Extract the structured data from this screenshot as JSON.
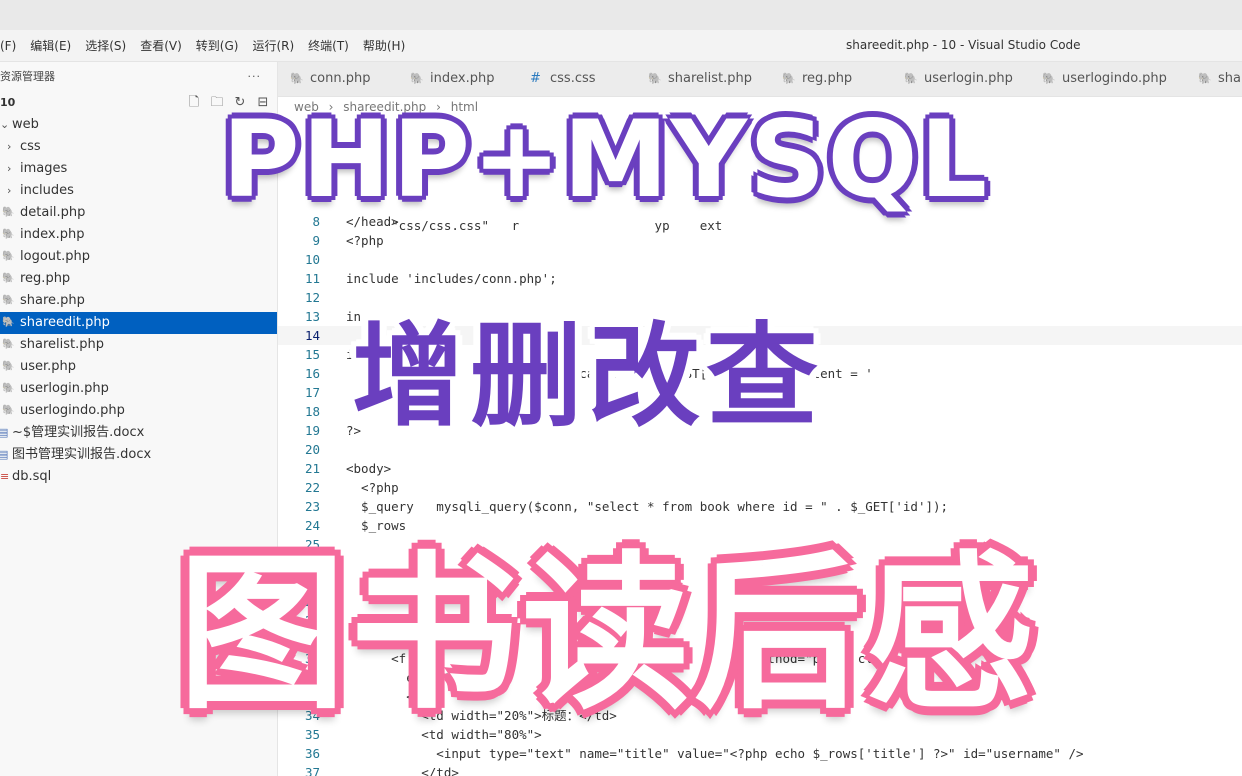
{
  "menubar": {
    "items": [
      "(F)",
      "编辑(E)",
      "选择(S)",
      "查看(V)",
      "转到(G)",
      "运行(R)",
      "终端(T)",
      "帮助(H)"
    ],
    "window_title": "shareedit.php - 10 - Visual Studio Code"
  },
  "explorer": {
    "header": "资源管理器",
    "more": "···",
    "folder": "10",
    "tree": [
      {
        "label": "web",
        "type": "folder-open"
      },
      {
        "label": "css",
        "type": "folder"
      },
      {
        "label": "images",
        "type": "folder"
      },
      {
        "label": "includes",
        "type": "folder"
      },
      {
        "label": "detail.php",
        "type": "php"
      },
      {
        "label": "index.php",
        "type": "php"
      },
      {
        "label": "logout.php",
        "type": "php"
      },
      {
        "label": "reg.php",
        "type": "php"
      },
      {
        "label": "share.php",
        "type": "php"
      },
      {
        "label": "shareedit.php",
        "type": "php",
        "selected": true
      },
      {
        "label": "sharelist.php",
        "type": "php"
      },
      {
        "label": "user.php",
        "type": "php"
      },
      {
        "label": "userlogin.php",
        "type": "php"
      },
      {
        "label": "userlogindo.php",
        "type": "php"
      },
      {
        "label": "~$管理实训报告.docx",
        "type": "docx"
      },
      {
        "label": "图书管理实训报告.docx",
        "type": "docx"
      },
      {
        "label": "db.sql",
        "type": "sql"
      }
    ]
  },
  "tabs": [
    "conn.php",
    "index.php",
    "css.css",
    "sharelist.php",
    "reg.php",
    "userlogin.php",
    "userlogindo.php",
    "shar"
  ],
  "breadcrumb": [
    "web",
    "shareedit.php",
    "html"
  ],
  "editor": {
    "lines": [
      {
        "n": "8",
        "text": "</head>"
      },
      {
        "n": "9",
        "text": "<?php"
      },
      {
        "n": "10",
        "text": ""
      },
      {
        "n": "11",
        "text": "include 'includes/conn.php';"
      },
      {
        "n": "12",
        "text": ""
      },
      {
        "n": "13",
        "text": "in"
      },
      {
        "n": "14",
        "text": ""
      },
      {
        "n": "15",
        "text": "if"
      },
      {
        "n": "16",
        "text": "                     title']}',catid = '{$_POST['catid']}',content = '"
      },
      {
        "n": "17",
        "text": ""
      },
      {
        "n": "18",
        "text": ""
      },
      {
        "n": "19",
        "text": "?>"
      },
      {
        "n": "20",
        "text": ""
      },
      {
        "n": "21",
        "text": "<body>"
      },
      {
        "n": "22",
        "text": "  <?php"
      },
      {
        "n": "23",
        "text": "  $_query   mysqli_query($conn, \"select * from book where id = \" . $_GET['id']);"
      },
      {
        "n": "24",
        "text": "  $_rows"
      },
      {
        "n": "25",
        "text": ""
      },
      {
        "n": "26",
        "text": ""
      },
      {
        "n": "27",
        "text": "    <h1>"
      },
      {
        "n": "28",
        "text": ""
      },
      {
        "n": "29",
        "text": ""
      },
      {
        "n": "30",
        "text": "      <?"
      },
      {
        "n": "31",
        "text": "      <f                                              method=\"post\" class=\"fo"
      },
      {
        "n": "32",
        "text": "        e width=\"100%"
      },
      {
        "n": "33",
        "text": "        <tr>"
      },
      {
        "n": "34",
        "text": "          <td width=\"20%\">标题：</td>"
      },
      {
        "n": "35",
        "text": "          <td width=\"80%\">"
      },
      {
        "n": "36",
        "text": "            <input type=\"text\" name=\"title\" value=\"<?php echo $_rows['title'] ?>\" id=\"username\" />"
      },
      {
        "n": "37",
        "text": "          </td>"
      }
    ],
    "top_fragments": [
      "      \"css/css.css\"   r                  yp    ext"
    ]
  },
  "overlay": {
    "title_en": "PHP+MYSQL",
    "title_cn1": "增删改查",
    "title_cn2": "图书读后感"
  },
  "colors": {
    "selection": "#0060c0",
    "overlay_purple": "#6a3fbf",
    "overlay_pink": "#f66a9c"
  }
}
